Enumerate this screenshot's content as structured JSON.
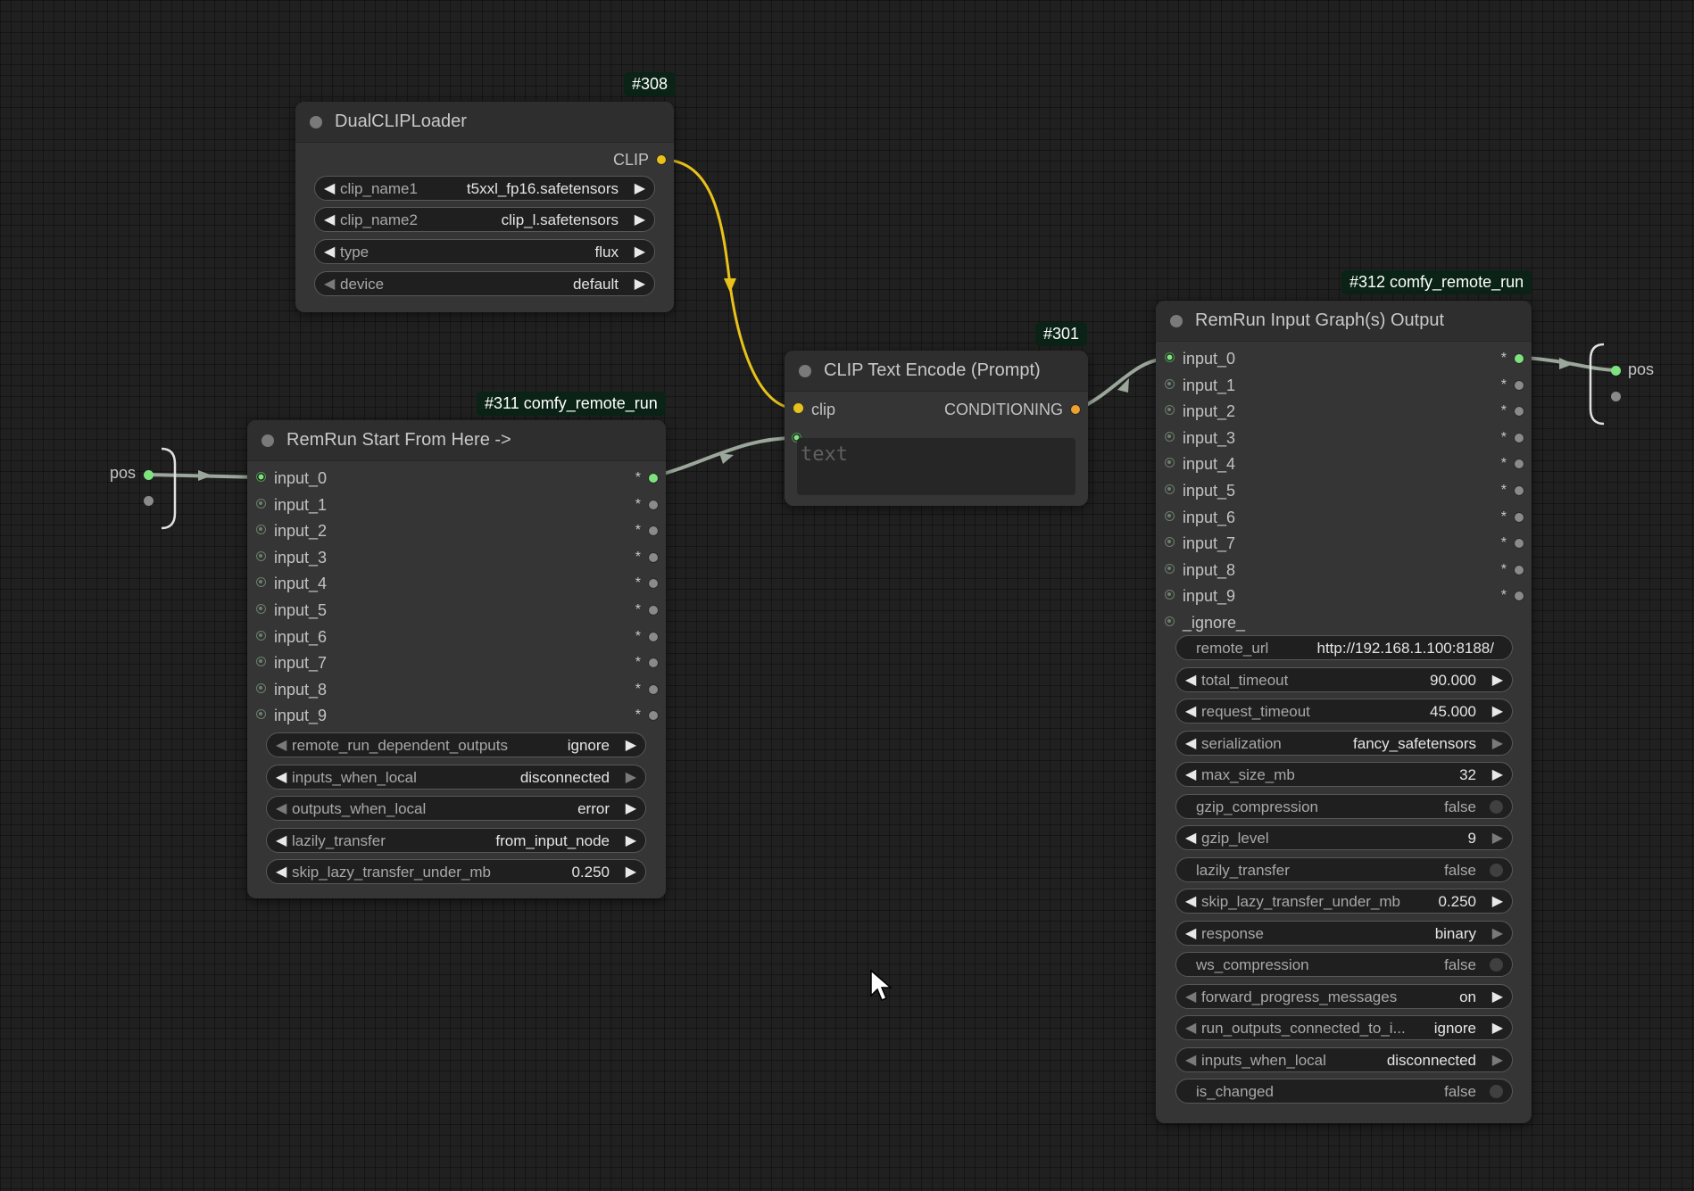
{
  "canvas": {
    "reroute_left_label": "pos",
    "reroute_right_label": "pos"
  },
  "nodes": {
    "dualcliploader": {
      "badge": "#308",
      "title": "DualCLIPLoader",
      "output": "CLIP",
      "widgets": [
        {
          "label": "clip_name1",
          "value": "t5xxl_fp16.safetensors"
        },
        {
          "label": "clip_name2",
          "value": "clip_l.safetensors"
        },
        {
          "label": "type",
          "value": "flux"
        },
        {
          "label": "device",
          "value": "default"
        }
      ]
    },
    "remrun_start": {
      "badge": "#311 comfy_remote_run",
      "title": "RemRun Start From Here ->",
      "inputs": [
        "input_0",
        "input_1",
        "input_2",
        "input_3",
        "input_4",
        "input_5",
        "input_6",
        "input_7",
        "input_8",
        "input_9"
      ],
      "output_marker": "*",
      "widgets": [
        {
          "label": "remote_run_dependent_outputs",
          "value": "ignore"
        },
        {
          "label": "inputs_when_local",
          "value": "disconnected"
        },
        {
          "label": "outputs_when_local",
          "value": "error"
        },
        {
          "label": "lazily_transfer",
          "value": "from_input_node"
        },
        {
          "label": "skip_lazy_transfer_under_mb",
          "value": "0.250"
        }
      ]
    },
    "clip_text_encode": {
      "badge": "#301",
      "title": "CLIP Text Encode (Prompt)",
      "input": "clip",
      "output": "CONDITIONING",
      "text_placeholder": "text"
    },
    "remrun_input": {
      "badge": "#312 comfy_remote_run",
      "title": "RemRun Input Graph(s) Output",
      "inputs": [
        "input_0",
        "input_1",
        "input_2",
        "input_3",
        "input_4",
        "input_5",
        "input_6",
        "input_7",
        "input_8",
        "input_9",
        "_ignore_"
      ],
      "output_marker": "*",
      "widgets": [
        {
          "label": "remote_url",
          "value": "http://192.168.1.100:8188/"
        },
        {
          "label": "total_timeout",
          "value": "90.000"
        },
        {
          "label": "request_timeout",
          "value": "45.000"
        },
        {
          "label": "serialization",
          "value": "fancy_safetensors"
        },
        {
          "label": "max_size_mb",
          "value": "32"
        },
        {
          "label": "gzip_compression",
          "value": "false"
        },
        {
          "label": "gzip_level",
          "value": "9"
        },
        {
          "label": "lazily_transfer",
          "value": "false"
        },
        {
          "label": "skip_lazy_transfer_under_mb",
          "value": "0.250"
        },
        {
          "label": "response",
          "value": "binary"
        },
        {
          "label": "ws_compression",
          "value": "false"
        },
        {
          "label": "forward_progress_messages",
          "value": "on"
        },
        {
          "label": "run_outputs_connected_to_i...",
          "value": "ignore"
        },
        {
          "label": "inputs_when_local",
          "value": "disconnected"
        },
        {
          "label": "is_changed",
          "value": "false"
        }
      ]
    }
  },
  "colors": {
    "clip_link": "#e8c21a",
    "generic_link": "#9aa79a",
    "conditioning": "#f0a030",
    "connected_slot": "#7ee37e"
  }
}
